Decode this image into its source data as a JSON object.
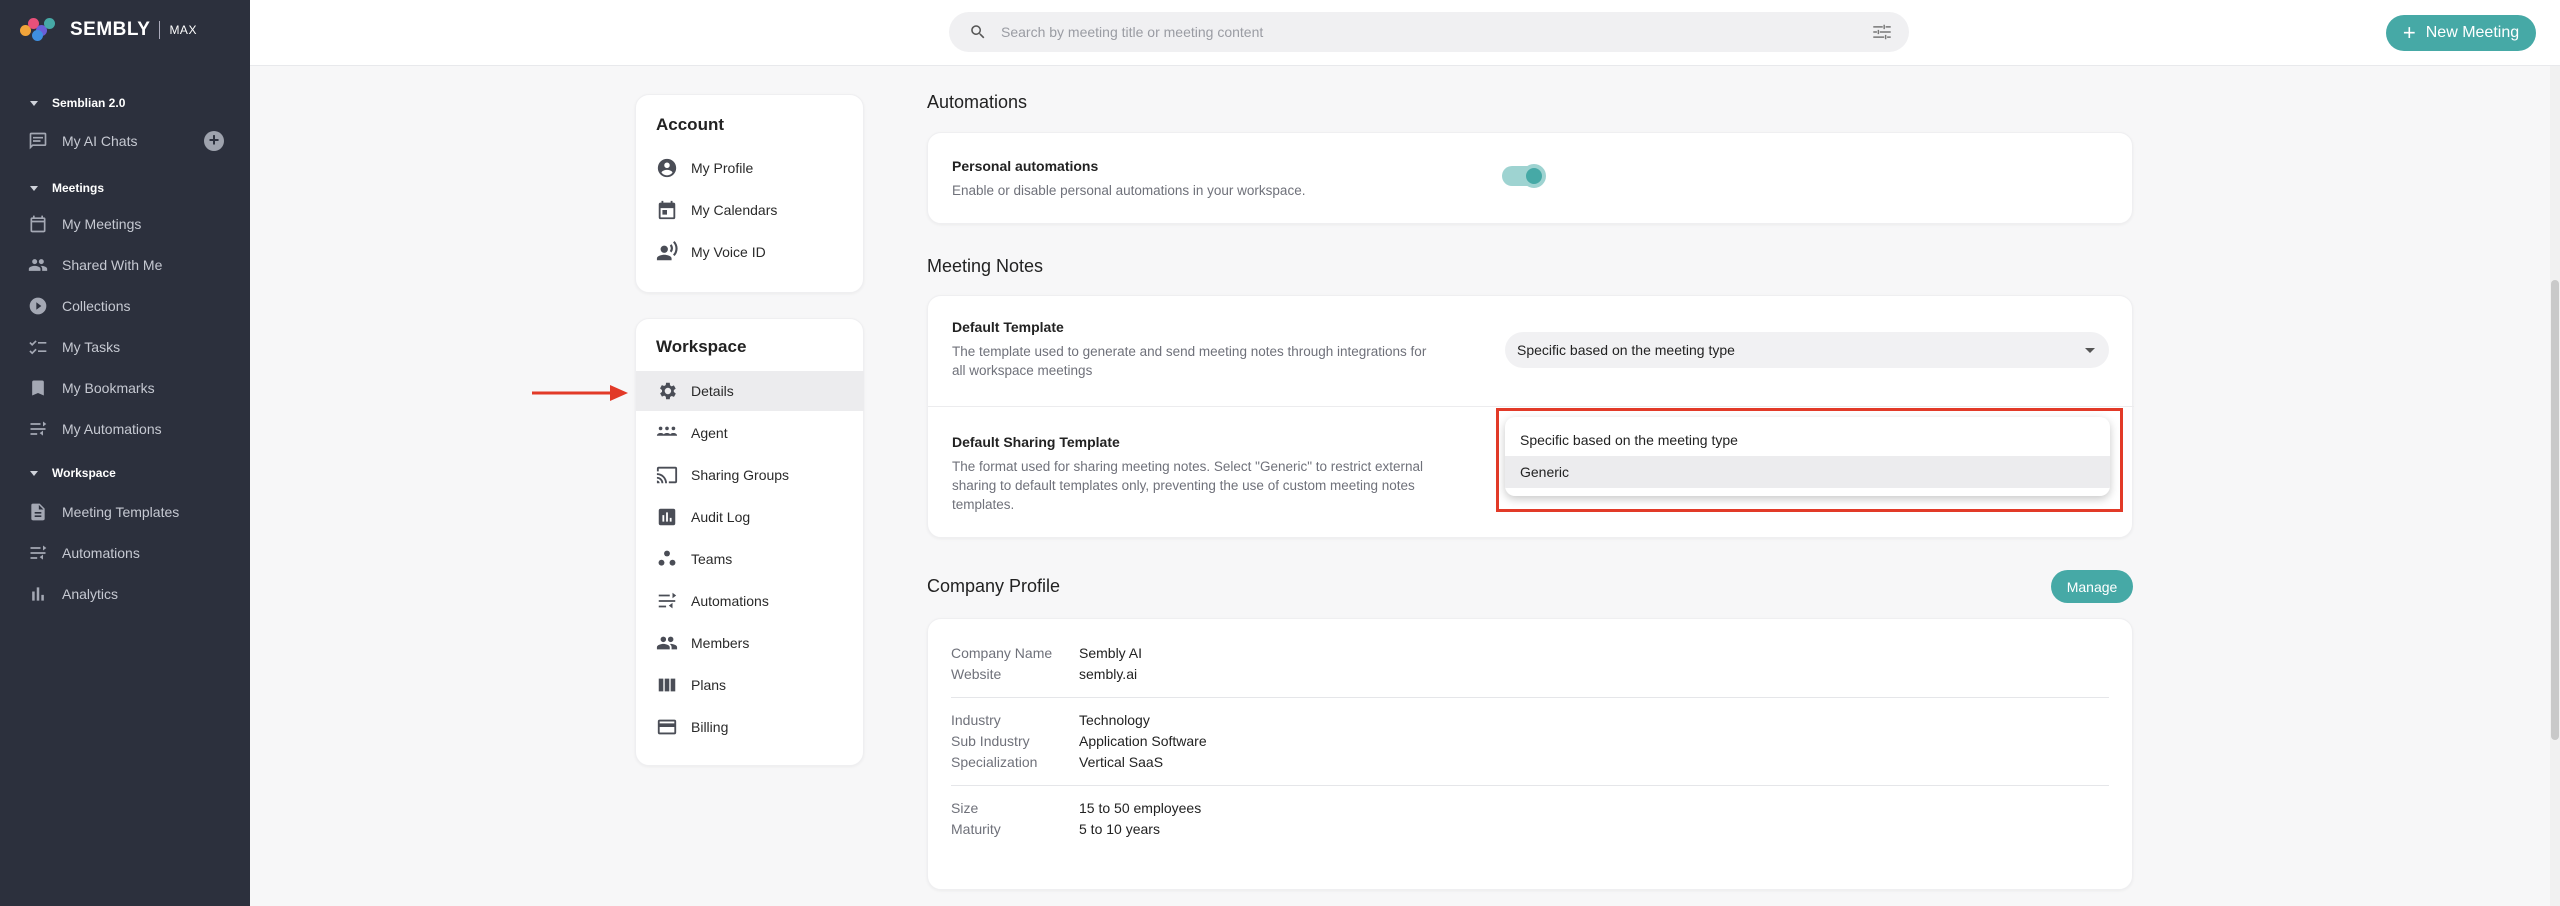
{
  "brand": {
    "name": "SEMBLY",
    "tier": "MAX"
  },
  "sidebar": {
    "sections": [
      {
        "label": "Semblian 2.0"
      },
      {
        "label": "Meetings"
      },
      {
        "label": "Workspace"
      }
    ],
    "items": [
      {
        "label": "My AI Chats",
        "icon": "chat-icon"
      },
      {
        "label": "My Meetings",
        "icon": "calendar-icon"
      },
      {
        "label": "Shared With Me",
        "icon": "people-icon"
      },
      {
        "label": "Collections",
        "icon": "play-circle-icon"
      },
      {
        "label": "My Tasks",
        "icon": "checklist-icon"
      },
      {
        "label": "My Bookmarks",
        "icon": "bookmark-icon"
      },
      {
        "label": "My Automations",
        "icon": "automation-icon"
      },
      {
        "label": "Meeting Templates",
        "icon": "document-icon"
      },
      {
        "label": "Automations",
        "icon": "automation-icon"
      },
      {
        "label": "Analytics",
        "icon": "bar-chart-icon"
      }
    ]
  },
  "topbar": {
    "search_placeholder": "Search by meeting title or meeting content",
    "new_meeting_label": "New Meeting"
  },
  "settings_nav": {
    "account_title": "Account",
    "account_items": [
      {
        "label": "My Profile"
      },
      {
        "label": "My Calendars"
      },
      {
        "label": "My Voice ID"
      }
    ],
    "workspace_title": "Workspace",
    "workspace_items": [
      {
        "label": "Details"
      },
      {
        "label": "Agent"
      },
      {
        "label": "Sharing Groups"
      },
      {
        "label": "Audit Log"
      },
      {
        "label": "Teams"
      },
      {
        "label": "Automations"
      },
      {
        "label": "Members"
      },
      {
        "label": "Plans"
      },
      {
        "label": "Billing"
      }
    ]
  },
  "automations": {
    "title": "Automations",
    "personal_title": "Personal automations",
    "personal_desc": "Enable or disable personal automations in your workspace.",
    "enabled": true
  },
  "meeting_notes": {
    "title": "Meeting Notes",
    "default_template_title": "Default Template",
    "default_template_desc_1": "The template used to generate and send meeting notes through integrations for",
    "default_template_desc_2": "all workspace meetings",
    "default_template_value": "Specific based on the meeting type",
    "sharing_template_title": "Default Sharing Template",
    "sharing_template_desc_1": "The format used for sharing meeting notes. Select \"Generic\" to restrict external",
    "sharing_template_desc_2": "sharing to default templates only, preventing the use of custom meeting notes",
    "sharing_template_desc_3": "templates.",
    "options": [
      "Specific based on the meeting type",
      "Generic"
    ]
  },
  "company_profile": {
    "title": "Company Profile",
    "manage_label": "Manage",
    "company_name_label": "Company Name",
    "company_name": "Sembly AI",
    "website_label": "Website",
    "website": "sembly.ai",
    "industry_label": "Industry",
    "industry": "Technology",
    "sub_industry_label": "Sub Industry",
    "sub_industry": "Application Software",
    "specialization_label": "Specialization",
    "specialization": "Vertical SaaS",
    "size_label": "Size",
    "size": "15 to 50 employees",
    "maturity_label": "Maturity",
    "maturity": "5 to 10 years"
  },
  "colors": {
    "accent": "#46a9a6",
    "sidebar_bg": "#2c303d",
    "highlight": "#e23a28"
  }
}
